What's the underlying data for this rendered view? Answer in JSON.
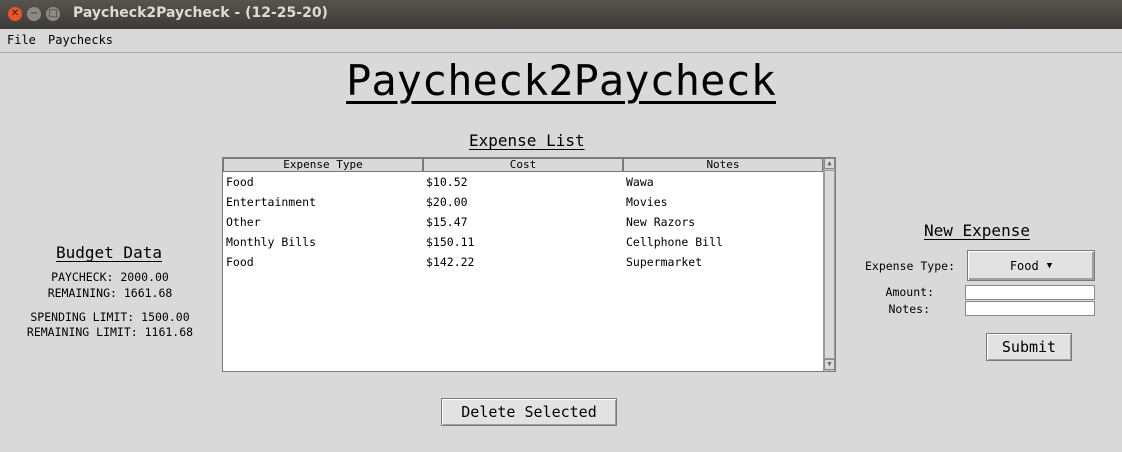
{
  "window": {
    "title": "Paycheck2Paycheck - (12-25-20)",
    "buttons": {
      "close": "✕",
      "minimize": "−",
      "maximize": "□"
    }
  },
  "menu": {
    "items": [
      "File",
      "Paychecks"
    ]
  },
  "app_title": "Paycheck2Paycheck",
  "budget": {
    "heading": "Budget Data",
    "paycheck": "PAYCHECK: 2000.00",
    "remaining": "REMAINING: 1661.68",
    "spending_limit": "SPENDING LIMIT: 1500.00",
    "remaining_limit": "REMAINING LIMIT: 1161.68"
  },
  "expense_list": {
    "heading": "Expense List",
    "columns": [
      "Expense Type",
      "Cost",
      "Notes"
    ],
    "rows": [
      [
        "Food",
        "$10.52",
        "Wawa"
      ],
      [
        "Entertainment",
        "$20.00",
        "Movies"
      ],
      [
        "Other",
        "$15.47",
        "New Razors"
      ],
      [
        "Monthly Bills",
        "$150.11",
        "Cellphone Bill"
      ],
      [
        "Food",
        "$142.22",
        "Supermarket"
      ]
    ],
    "delete_label": "Delete Selected"
  },
  "new_expense": {
    "heading": "New Expense",
    "type_label": "Expense Type:",
    "type_value": "Food",
    "amount_label": "Amount:",
    "amount_value": "",
    "notes_label": "Notes:",
    "notes_value": "",
    "submit_label": "Submit"
  }
}
